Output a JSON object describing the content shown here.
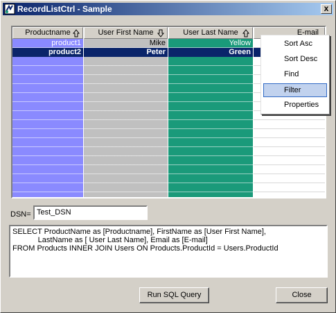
{
  "window": {
    "title": "RecordListCtrl - Sample",
    "close_glyph": "x"
  },
  "grid": {
    "columns": [
      {
        "label": "Productname",
        "icon": "sort-up-icon"
      },
      {
        "label": "User First Name",
        "icon": "sort-down-icon"
      },
      {
        "label": "User Last Name",
        "icon": "sort-up-icon"
      },
      {
        "label": "E-mail",
        "icon": ""
      }
    ],
    "rows": [
      {
        "productname": "product1",
        "first_name": "Mike",
        "last_name": "Yellow",
        "email": ""
      },
      {
        "productname": "product2",
        "first_name": "Peter",
        "last_name": "Green",
        "email": ""
      }
    ],
    "selected_row": 1,
    "colors": {
      "col1": "#8a8aff",
      "col2": "#c0c0c0",
      "col3": "#1a9a7a",
      "selection": "#0a246a"
    }
  },
  "context_menu": {
    "items": [
      "Sort Asc",
      "Sort Desc",
      "Find",
      "Filter",
      "Properties"
    ],
    "highlighted": "Filter"
  },
  "dsn": {
    "label": "DSN=",
    "value": "Test_DSN"
  },
  "sql": {
    "lines": [
      "SELECT ProductName as [Productname], FirstName as [User First Name],",
      "            LastName as [ User Last Name], Email as [E-mail]",
      "FROM Products INNER JOIN Users ON Products.ProductId = Users.ProductId"
    ]
  },
  "buttons": {
    "run_sql": "Run SQL Query",
    "close": "Close"
  }
}
